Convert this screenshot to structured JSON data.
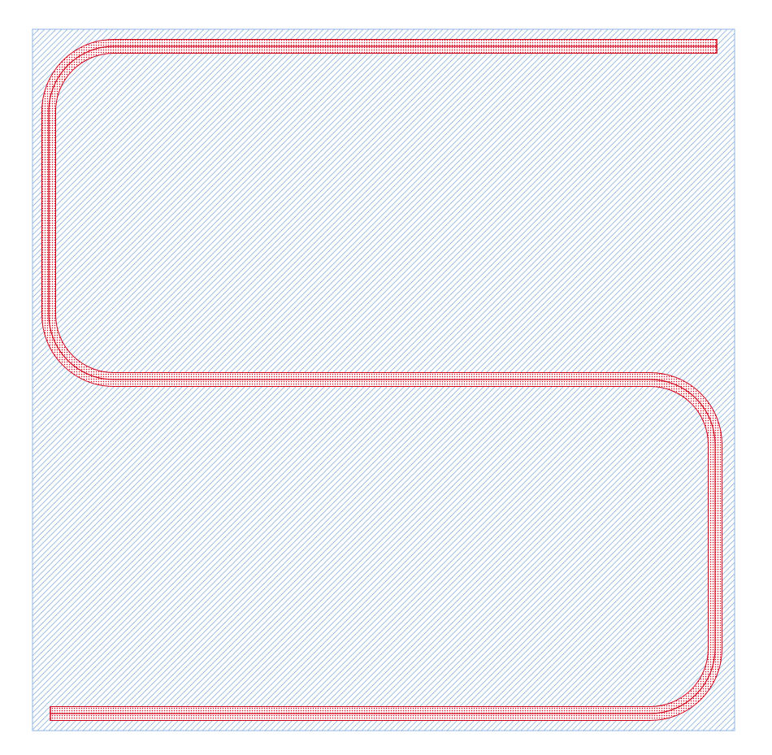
{
  "layout_view": {
    "layers": [
      {
        "name": "substrate",
        "fill": "hatch",
        "color": "#8fb4e6"
      },
      {
        "name": "waveguide",
        "fill": "dotted",
        "color": "#d0021b"
      }
    ],
    "waveguide_shape": "serpentine"
  }
}
